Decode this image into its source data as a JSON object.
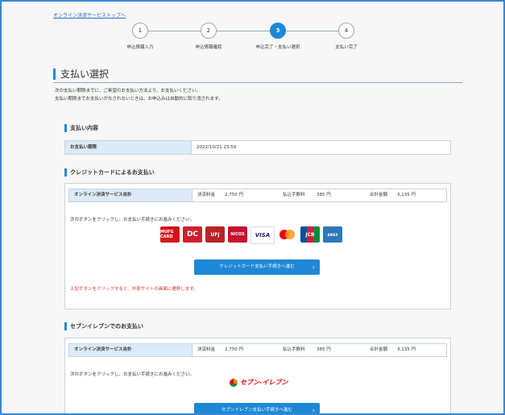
{
  "top_link": "オンライン決済サービストップへ",
  "steps": [
    {
      "number": "1",
      "label": "申込情報入力"
    },
    {
      "number": "2",
      "label": "申込情報確認"
    },
    {
      "number": "3",
      "label": "申込完了・支払い選択"
    },
    {
      "number": "4",
      "label": "支払い完了"
    }
  ],
  "page_title": "支払い選択",
  "intro_line1": "次の支払い期限までに、ご希望のお支払い方法より、お支払いください。",
  "intro_line2": "支払い期限までお支払いがなされないときは、お申込みは自動的に取り消されます。",
  "payment_details": {
    "title": "支払い内容",
    "period_label": "お支払い期限",
    "period_value": "2022/10/21 23:59"
  },
  "credit": {
    "title": "クレジットカードによるお支払い",
    "row_label": "オンライン決済サービス合計",
    "fee_label": "決済料金",
    "fee_value": "2,750 円",
    "transfer_label": "払込手数料",
    "transfer_value": "385 円",
    "total_label": "合計金額",
    "total_value": "3,135 円",
    "instruction": "次のボタンをクリックし、お支払い手続きにお進みください。",
    "logos": {
      "mufg": "MUFG CARD",
      "dc": "DC",
      "ufj": "UFJ",
      "nicos": "NICOS",
      "visa": "VISA",
      "jcb": "JCB",
      "amex": "AMEX"
    },
    "button_label": "クレジットカード支払い手続きへ進む",
    "warning": "上記ボタンをクリックすると、外部サイトの画面に遷移します。"
  },
  "seven": {
    "title": "セブンイレブンでのお支払い",
    "row_label": "オンライン決済サービス合計",
    "fee_label": "決済料金",
    "fee_value": "2,750 円",
    "transfer_label": "払込手数料",
    "transfer_value": "385 円",
    "total_label": "合計金額",
    "total_value": "3,135 円",
    "instruction": "次のボタンをクリックし、お支払い手続きにお進みください。",
    "logo_text": "セブン-イレブン",
    "button_label": "セブンイレブン支払い手続きへ進む"
  },
  "colors": {
    "accent": "#1e88d6",
    "warning": "#e0352b",
    "header_cell": "#dcebf8"
  }
}
